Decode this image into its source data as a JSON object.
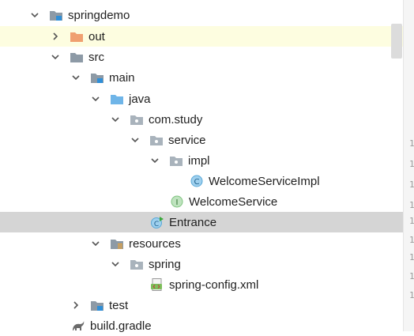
{
  "tree": {
    "items": [
      {
        "label": "springdemo",
        "expanded": true,
        "icon": "module-folder-icon"
      },
      {
        "label": "out",
        "expanded": false,
        "icon": "orange-folder-icon"
      },
      {
        "label": "src",
        "expanded": true,
        "icon": "folder-icon"
      },
      {
        "label": "main",
        "expanded": true,
        "icon": "module-folder-icon"
      },
      {
        "label": "java",
        "expanded": true,
        "icon": "source-folder-icon"
      },
      {
        "label": "com.study",
        "expanded": true,
        "icon": "package-icon"
      },
      {
        "label": "service",
        "expanded": true,
        "icon": "package-icon"
      },
      {
        "label": "impl",
        "expanded": true,
        "icon": "package-icon"
      },
      {
        "label": "WelcomeServiceImpl",
        "icon": "class-icon",
        "icon_letter": "C"
      },
      {
        "label": "WelcomeService",
        "icon": "interface-icon",
        "icon_letter": "I"
      },
      {
        "label": "Entrance",
        "icon": "runnable-class-icon",
        "icon_letter": "C"
      },
      {
        "label": "resources",
        "expanded": true,
        "icon": "resources-folder-icon"
      },
      {
        "label": "spring",
        "expanded": true,
        "icon": "package-icon"
      },
      {
        "label": "spring-config.xml",
        "icon": "xml-file-icon"
      },
      {
        "label": "test",
        "expanded": false,
        "icon": "module-folder-icon"
      },
      {
        "label": "build.gradle",
        "icon": "gradle-icon"
      }
    ]
  },
  "gutter": {
    "line_numbers": [
      "1",
      "1",
      "1",
      "1",
      "1",
      "1",
      "1",
      "1",
      "1"
    ]
  },
  "colors": {
    "folder": "#8d9aa6",
    "orange_folder": "#f0a070",
    "source_folder": "#6fb5e8",
    "module_badge": "#2f8fd8",
    "class_circle": "#5aa9d8",
    "interface_circle": "#7fc47f",
    "selected_row": "#d5d5d5",
    "highlight_row": "#fdfde0"
  }
}
